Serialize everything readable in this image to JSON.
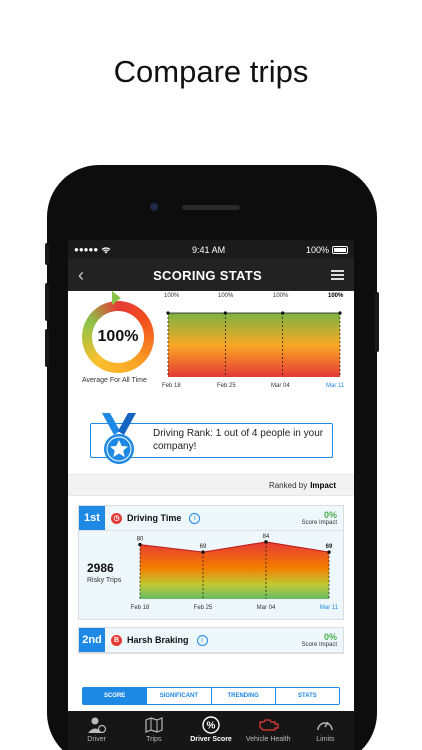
{
  "headline": "Compare trips",
  "status": {
    "time": "9:41 AM",
    "battery": "100%"
  },
  "nav": {
    "title": "SCORING STATS"
  },
  "overview": {
    "score": "100%",
    "avg_label": "Average For All Time",
    "mini_chart": {
      "points": [
        "100%",
        "100%",
        "100%",
        "100%"
      ],
      "dates": [
        "Feb 18",
        "Feb 25",
        "Mar 04",
        "Mar 11"
      ]
    }
  },
  "rank": {
    "text": "Driving Rank: 1 out of 4 people in your company!"
  },
  "ranked_by": {
    "prefix": "Ranked by",
    "value": "Impact"
  },
  "cards": [
    {
      "rank": "1st",
      "icon_letter": "",
      "name": "Driving Time",
      "impact_pct": "0%",
      "impact_label": "Score Impact",
      "risky_count": "2986",
      "risky_label": "Risky Trips"
    },
    {
      "rank": "2nd",
      "icon_letter": "B",
      "name": "Harsh Braking",
      "impact_pct": "0%",
      "impact_label": "Score Impact"
    }
  ],
  "chart_data": {
    "type": "area",
    "title": "",
    "categories": [
      "Feb 18",
      "Feb 25",
      "Mar 04",
      "Mar 11"
    ],
    "series": [
      {
        "values": [
          80,
          69,
          84,
          69
        ]
      }
    ],
    "labels": [
      "80",
      "69",
      "84",
      "69"
    ]
  },
  "tabs": [
    "SCORE",
    "SIGNIFICANT",
    "TRENDING",
    "STATS"
  ],
  "bottom_nav": [
    {
      "label": "Driver",
      "icon": "driver-icon"
    },
    {
      "label": "Trips",
      "icon": "map-icon"
    },
    {
      "label": "Driver Score",
      "icon": "percent-icon",
      "active": true
    },
    {
      "label": "Vehicle Health",
      "icon": "engine-icon"
    },
    {
      "label": "Limits",
      "icon": "speedometer-icon"
    }
  ],
  "colors": {
    "accent": "#1e88e5",
    "good": "#4caf50",
    "bad": "#e53935"
  }
}
